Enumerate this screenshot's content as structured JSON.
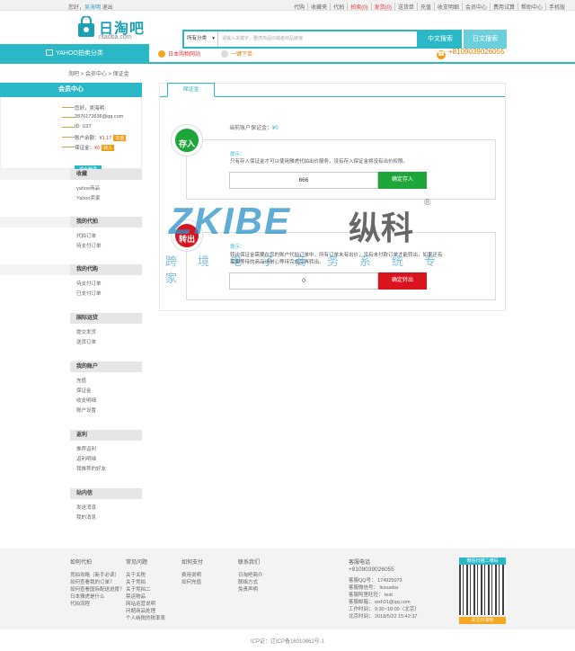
{
  "topbar": {
    "greeting": "您好，",
    "user": "吴海明",
    "logout": "退出",
    "links": [
      "代购",
      "收藏夹",
      "代拍",
      "拍卖(0)",
      "发货(0)",
      "送货单",
      "充值",
      "收支明细",
      "会员中心",
      "费用试算",
      "帮助中心",
      "手机版"
    ]
  },
  "logo": {
    "cn": "日淘吧",
    "en": "ritaoba.com"
  },
  "search": {
    "category": "所有分类",
    "placeholder": "请输入关键字，雅虎商品ID或者商品链接",
    "btn_cn": "中文搜索",
    "btn_jp": "日文搜索"
  },
  "nav": {
    "yahoo": "YAHOO拍卖分类",
    "jp_site": "日本购物网站",
    "one_click": "一键下单",
    "phone": "+8109039026055"
  },
  "breadcrumb": "淘吧 > 会员中心 > 保证金",
  "sidebar": {
    "title": "会员中心",
    "user": {
      "hello": "您好，吴海明",
      "email": "2876172636@qq.com",
      "id": "ID: U27",
      "balance_label": "账户余额：",
      "balance": "¥1.17",
      "recharge": "充值",
      "deposit_label": "保证金：",
      "deposit": "¥0",
      "deposit_btn": "转入",
      "logout": "退出登录"
    },
    "sections": [
      {
        "title": "收藏",
        "items": [
          "yahoo商品",
          "Yahoo卖家"
        ]
      },
      {
        "title": "我的代拍",
        "items": [
          "代拍订单",
          "待支付订单"
        ]
      },
      {
        "title": "我的代购",
        "items": [
          "待支付订单",
          "已支付订单"
        ]
      },
      {
        "title": "国际运货",
        "items": [
          "提交发货",
          "送货订单"
        ]
      },
      {
        "title": "我的账户",
        "items": [
          "充值",
          "保证金",
          "收支明细",
          "账户设置"
        ]
      },
      {
        "title": "返利",
        "items": [
          "推荐返利",
          "返利明细",
          "我推荐的好友"
        ]
      },
      {
        "title": "站内信",
        "items": [
          "发送消息",
          "我的消息"
        ]
      }
    ]
  },
  "main": {
    "tab": "保证金",
    "balance_label": "当前账户保证金：",
    "balance": "¥0",
    "deposit_in": {
      "badge": "存入",
      "tip": "提示：",
      "text": "只有存入保证金才可以使用雅虎代拍出价服务，没有存入保证金将没有出价权限。",
      "amount": "666",
      "button": "确定存入"
    },
    "deposit_out": {
      "badge": "转出",
      "tip": "提示：",
      "text": "转出保证金需要在您的账户代拍订单中，所有订单未有出价，没有未付款订单才能转出，如果还有需要等待的商品请耐心等待完成后再转出。",
      "amount": "0",
      "button": "确定转出"
    }
  },
  "watermark": {
    "brand": "ZKIBE",
    "cn": "纵科",
    "reg": "®",
    "sub": "跨境电子商务系统专家"
  },
  "footer": {
    "cols": [
      {
        "title": "如何代拍",
        "items": [
          "竞拍攻略（新手必读）",
          "如何查看我的订单？",
          "如何查看国际配送进度？",
          "日本雅虎是什么",
          "代拍流程"
        ]
      },
      {
        "title": "常见问题",
        "items": [
          "关于关税",
          "关于竞拍",
          "关于竞拍二",
          "禁运物品",
          "网站运营说明",
          "问题商品处理",
          "个人纳税的税率表"
        ]
      },
      {
        "title": "如何支付",
        "items": [
          "费用说明",
          "如何充值"
        ]
      },
      {
        "title": "联系我们",
        "items": [
          "日淘吧简介",
          "联络方式",
          "免责声明"
        ]
      }
    ],
    "service": {
      "title": "客服电话",
      "phone": "+8109039026055",
      "lines": [
        "客服QQ号： 174925073",
        "客服微信号： liuxueba",
        "客服阿里旺旺： test",
        "客服邮箱： wxh31@qq.com",
        "工作时间： 9:30~18:00（北京）",
        "北京时间： 2018/5/22 15:42:37"
      ]
    },
    "qr_top": "微信扫描二维码",
    "qr_bottom": "关注日淘吧"
  },
  "icp": "ICP证：辽ICP备16010862号-1"
}
